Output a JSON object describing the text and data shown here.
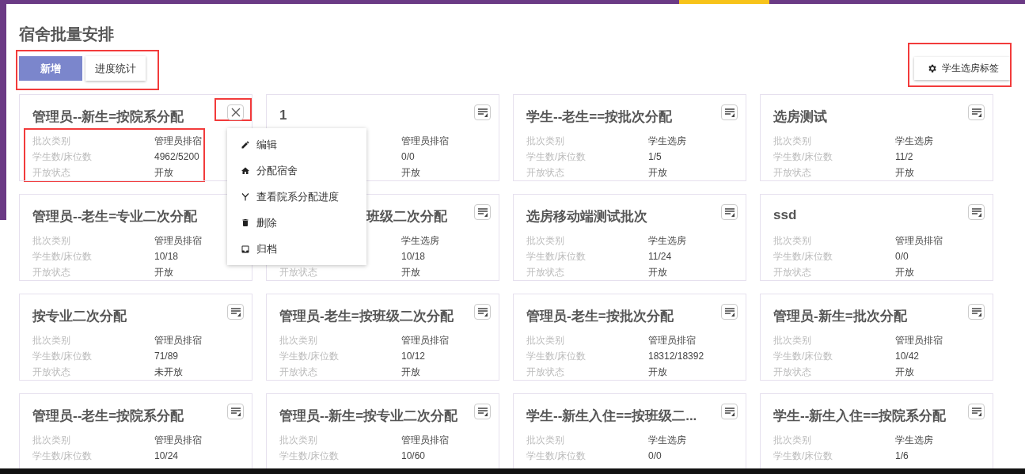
{
  "page_title": "宿舍批量安排",
  "toolbar": {
    "buttons": [
      {
        "label": "新增",
        "kind": "primary"
      },
      {
        "label": "进度统计",
        "kind": "default"
      }
    ],
    "tag_button": "学生选房标签"
  },
  "context_menu": {
    "items": [
      {
        "label": "编辑",
        "kind": "edit"
      },
      {
        "label": "分配宿舍",
        "kind": "home"
      },
      {
        "label": "查看院系分配进度",
        "kind": "fork"
      },
      {
        "label": "删除",
        "kind": "delete"
      },
      {
        "label": "归档",
        "kind": "archive"
      }
    ]
  },
  "cards": [
    {
      "title": "管理员--新生=按院系分配",
      "menu_open": true,
      "fields": [
        {
          "label": "批次类别",
          "value": "管理员排宿"
        },
        {
          "label": "学生数/床位数",
          "value": "4962/5200"
        },
        {
          "label": "开放状态",
          "value": "开放"
        }
      ]
    },
    {
      "title": "1",
      "menu_open": false,
      "fields": [
        {
          "value": "管理员排宿"
        },
        {
          "value": "0/0"
        },
        {
          "value": "开放"
        }
      ]
    },
    {
      "title": "学生--老生==按批次分配",
      "menu_open": false,
      "fields": [
        {
          "label": "批次类别",
          "value": "学生选房"
        },
        {
          "label": "学生数/床位数",
          "value": "1/5"
        },
        {
          "label": "开放状态",
          "value": "开放"
        }
      ]
    },
    {
      "title": "选房测试",
      "menu_open": false,
      "fields": [
        {
          "label": "批次类别",
          "value": "学生选房"
        },
        {
          "label": "学生数/床位数",
          "value": "11/2"
        },
        {
          "label": "开放状态",
          "value": "开放"
        }
      ]
    },
    {
      "title": "管理员--老生=专业二次分配",
      "menu_open": false,
      "fields": [
        {
          "label": "批次类别",
          "value": "管理员排宿"
        },
        {
          "label": "学生数/床位数",
          "value": "10/18"
        },
        {
          "label": "开放状态",
          "value": "开放"
        }
      ]
    },
    {
      "title": "班级二次分配",
      "menu_open": false,
      "fields": [
        {
          "value": "学生选房"
        },
        {
          "value": "10/18"
        },
        {
          "label": "开放状态",
          "value": "开放"
        }
      ]
    },
    {
      "title": "选房移动端测试批次",
      "menu_open": false,
      "fields": [
        {
          "label": "批次类别",
          "value": "学生选房"
        },
        {
          "label": "学生数/床位数",
          "value": "11/24"
        },
        {
          "label": "开放状态",
          "value": "开放"
        }
      ]
    },
    {
      "title": "ssd",
      "menu_open": false,
      "fields": [
        {
          "label": "批次类别",
          "value": "管理员排宿"
        },
        {
          "label": "学生数/床位数",
          "value": "0/0"
        },
        {
          "label": "开放状态",
          "value": "开放"
        }
      ]
    },
    {
      "title": "按专业二次分配",
      "menu_open": false,
      "fields": [
        {
          "label": "批次类别",
          "value": "管理员排宿"
        },
        {
          "label": "学生数/床位数",
          "value": "71/89"
        },
        {
          "label": "开放状态",
          "value": "未开放"
        }
      ]
    },
    {
      "title": "管理员-老生=按班级二次分配",
      "menu_open": false,
      "fields": [
        {
          "label": "批次类别",
          "value": "管理员排宿"
        },
        {
          "label": "学生数/床位数",
          "value": "10/12"
        },
        {
          "label": "开放状态",
          "value": "开放"
        }
      ]
    },
    {
      "title": "管理员-老生=按批次分配",
      "menu_open": false,
      "fields": [
        {
          "label": "批次类别",
          "value": "管理员排宿"
        },
        {
          "label": "学生数/床位数",
          "value": "18312/18392"
        },
        {
          "label": "开放状态",
          "value": "开放"
        }
      ]
    },
    {
      "title": "管理员-新生=批次分配",
      "menu_open": false,
      "fields": [
        {
          "label": "批次类别",
          "value": "管理员排宿"
        },
        {
          "label": "学生数/床位数",
          "value": "10/42"
        },
        {
          "label": "开放状态",
          "value": "开放"
        }
      ]
    },
    {
      "title": "管理员--老生=按院系分配",
      "menu_open": false,
      "fields": [
        {
          "label": "批次类别",
          "value": "管理员排宿"
        },
        {
          "label": "学生数/床位数",
          "value": "10/24"
        }
      ]
    },
    {
      "title": "管理员--新生=按专业二次分配",
      "menu_open": false,
      "fields": [
        {
          "label": "批次类别",
          "value": "管理员排宿"
        },
        {
          "label": "学生数/床位数",
          "value": "10/60"
        }
      ]
    },
    {
      "title": "学生--新生入住==按班级二...",
      "menu_open": false,
      "fields": [
        {
          "label": "批次类别",
          "value": "学生选房"
        },
        {
          "label": "学生数/床位数",
          "value": "0/0"
        }
      ]
    },
    {
      "title": "学生--新生入住==按院系分配",
      "menu_open": false,
      "fields": [
        {
          "label": "批次类别",
          "value": "学生选房"
        },
        {
          "label": "学生数/床位数",
          "value": "1/6"
        }
      ]
    }
  ]
}
